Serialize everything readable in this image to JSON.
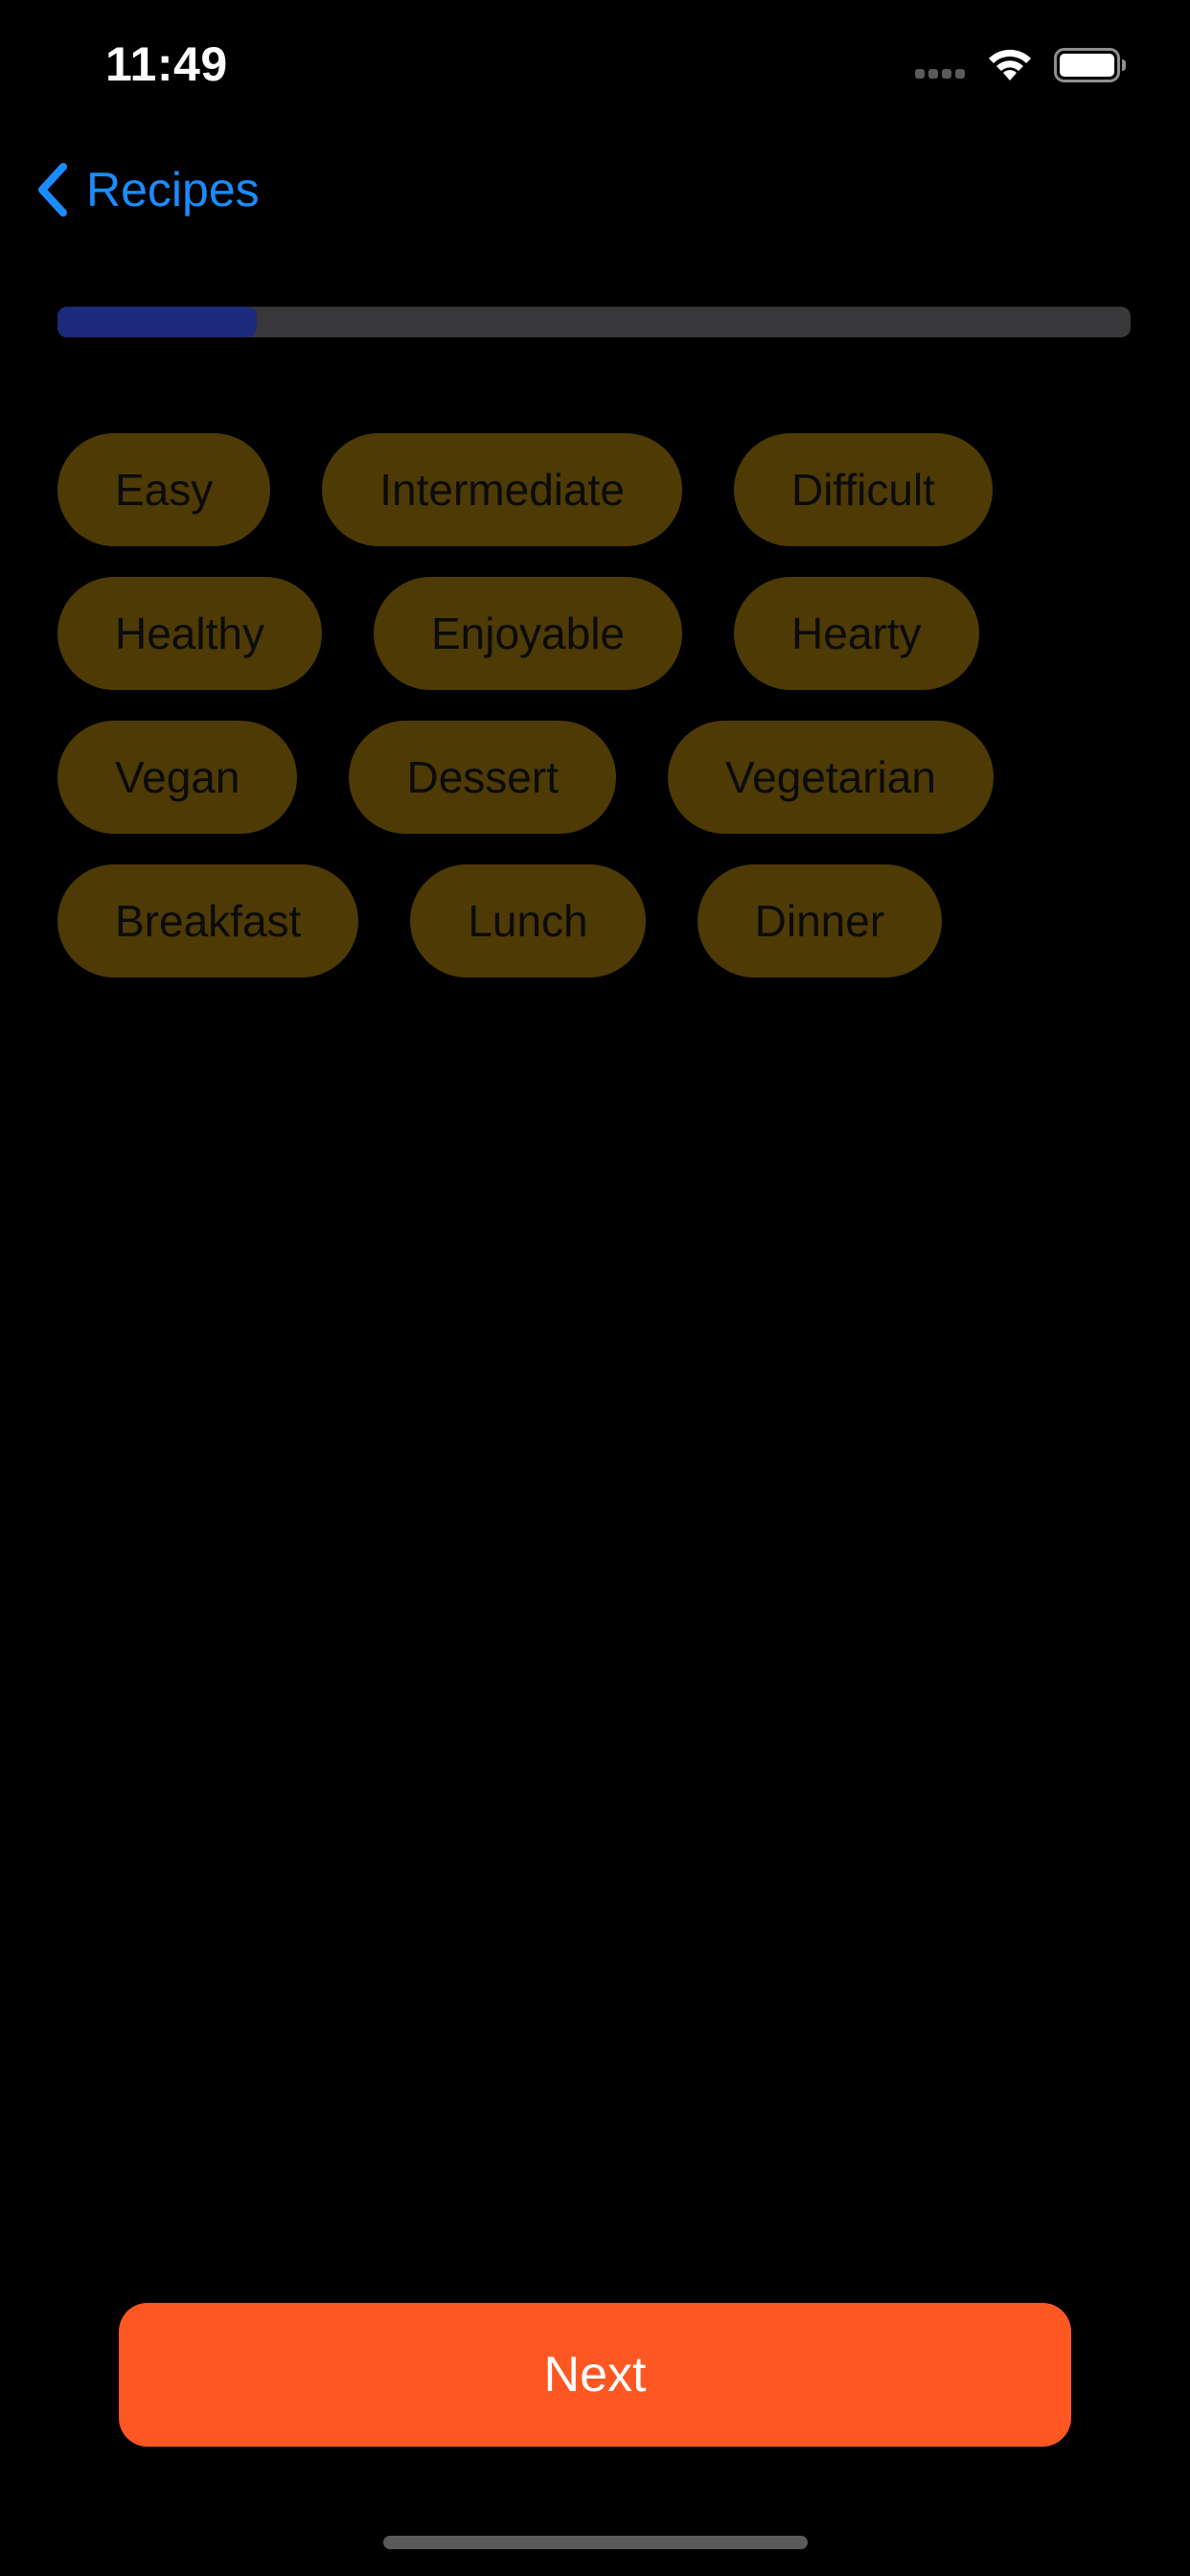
{
  "status_bar": {
    "time": "11:49"
  },
  "nav": {
    "back_label": "Recipes"
  },
  "progress": {
    "fraction": 0.186,
    "track_color": "#38383a",
    "fill_color": "#1b2a7a"
  },
  "chips": {
    "rows": [
      [
        "Easy",
        "Intermediate",
        "Difficult"
      ],
      [
        "Healthy",
        "Enjoyable",
        "Hearty"
      ],
      [
        "Vegan",
        "Dessert",
        "Vegetarian"
      ],
      [
        "Breakfast",
        "Lunch",
        "Dinner"
      ]
    ],
    "background_color": "#4d3a05"
  },
  "footer": {
    "next_label": "Next",
    "button_color": "#ff5722"
  },
  "colors": {
    "accent": "#1a8cff",
    "background": "#000000"
  }
}
